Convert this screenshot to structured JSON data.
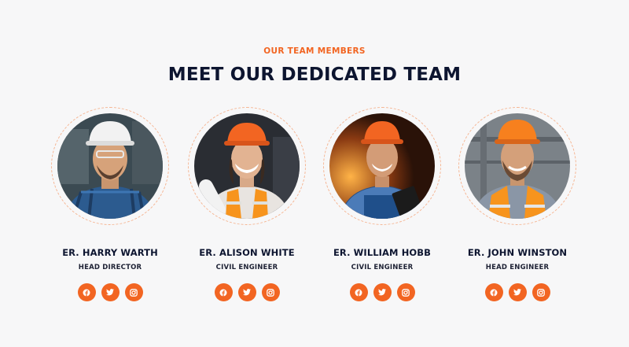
{
  "section": {
    "eyebrow": "OUR TEAM MEMBERS",
    "title": "MEET OUR DEDICATED TEAM"
  },
  "team": [
    {
      "name": "ER. HARRY WARTH",
      "role": "HEAD DIRECTOR",
      "helmet": "white",
      "vest": "none"
    },
    {
      "name": "ER. ALISON WHITE",
      "role": "CIVIL ENGINEER",
      "helmet": "orange",
      "vest": "orange"
    },
    {
      "name": "ER. WILLIAM HOBB",
      "role": "CIVIL ENGINEER",
      "helmet": "orange",
      "vest": "blue-overalls"
    },
    {
      "name": "ER. JOHN WINSTON",
      "role": "HEAD ENGINEER",
      "helmet": "orange",
      "vest": "orange"
    }
  ],
  "social_icons": [
    "facebook-icon",
    "twitter-icon",
    "instagram-icon"
  ],
  "colors": {
    "accent": "#f26522",
    "heading": "#0d1530",
    "background": "#f7f7f8"
  }
}
